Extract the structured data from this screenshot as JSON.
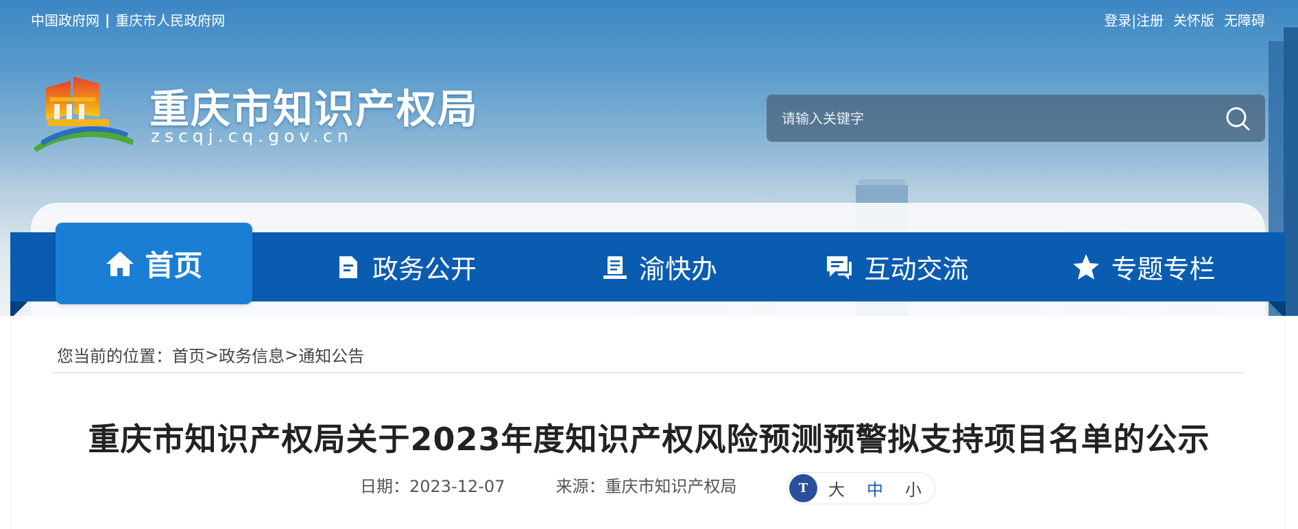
{
  "header": {
    "top_links_left": [
      "中国政府网",
      "重庆市人民政府网"
    ],
    "top_links_separator": "|",
    "top_links_right": [
      "登录|注册",
      "关怀版",
      "无障碍"
    ],
    "site_title": "重庆市知识产权局",
    "site_domain": "zscqj.cq.gov.cn",
    "search": {
      "placeholder": "请输入关键字",
      "value": ""
    }
  },
  "nav": {
    "items": [
      {
        "label": "首页",
        "icon": "home-icon",
        "active": true
      },
      {
        "label": "政务公开",
        "icon": "document-icon",
        "active": false
      },
      {
        "label": "渝快办",
        "icon": "service-icon",
        "active": false
      },
      {
        "label": "互动交流",
        "icon": "chat-icon",
        "active": false
      },
      {
        "label": "专题专栏",
        "icon": "star-icon",
        "active": false
      }
    ]
  },
  "breadcrumb": {
    "prefix": "您当前的位置：",
    "items": [
      "首页",
      "政务信息",
      "通知公告"
    ],
    "separator": ">"
  },
  "article": {
    "title": "重庆市知识产权局关于2023年度知识产权风险预测预警拟支持项目名单的公示",
    "date_label": "日期：",
    "date": "2023-12-07",
    "source_label": "来源：",
    "source": "重庆市知识产权局"
  },
  "font_size_control": {
    "icon_text": "T",
    "options": [
      "大",
      "中",
      "小"
    ],
    "selected": "中"
  },
  "colors": {
    "nav_bg": "#0a5cb0",
    "nav_active_bg": "#1a7fd4",
    "font_icon_bg": "#2b4f9a"
  }
}
